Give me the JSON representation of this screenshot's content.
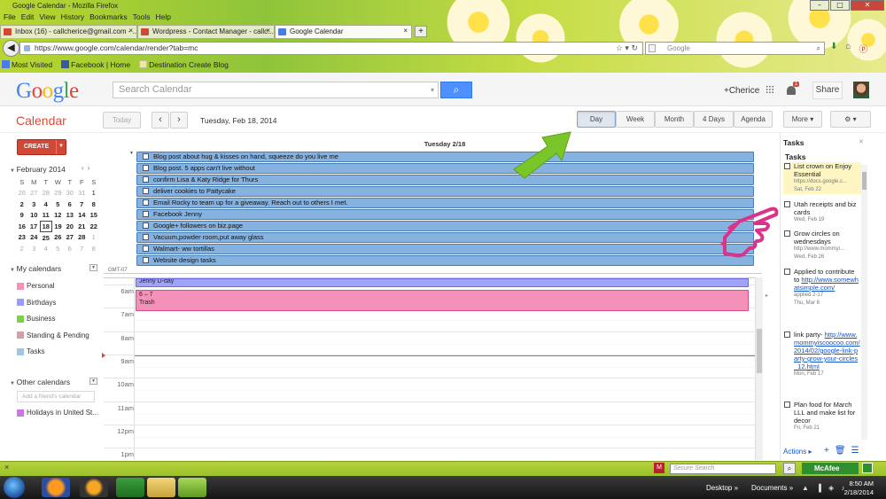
{
  "browser": {
    "window_title": "Google Calendar - Mozilla Firefox",
    "menu": [
      "File",
      "Edit",
      "View",
      "History",
      "Bookmarks",
      "Tools",
      "Help"
    ],
    "tabs": [
      {
        "label": "Inbox (16) - callcherice@gmail.com - ..."
      },
      {
        "label": "Wordpress - Contact Manager - callc..."
      },
      {
        "label": "Google Calendar"
      }
    ],
    "new_tab": "+",
    "url": "https://www.google.com/calendar/render?tab=mc",
    "search_placeholder": "Google",
    "bookmarks": [
      "Most Visited",
      "Facebook | Home",
      "Destination Create Blog"
    ]
  },
  "google_bar": {
    "logo": "Google",
    "search_placeholder": "Search Calendar",
    "user": "+Cherice",
    "notifications": "1",
    "share": "Share"
  },
  "calendar": {
    "title": "Calendar",
    "today": "Today",
    "date_label": "Tuesday, Feb 18, 2014",
    "views": [
      "Day",
      "Week",
      "Month",
      "4 Days",
      "Agenda"
    ],
    "selected_view": "Day",
    "more": "More ▾",
    "settings": "⚙ ▾",
    "create": "CREATE",
    "day_header": "Tuesday 2/18",
    "gmt": "GMT-07",
    "mini": {
      "month": "February 2014",
      "weekdays": [
        "S",
        "M",
        "T",
        "W",
        "T",
        "F",
        "S"
      ],
      "weeks": [
        [
          "26",
          "27",
          "28",
          "29",
          "30",
          "31",
          "1"
        ],
        [
          "2",
          "3",
          "4",
          "5",
          "6",
          "7",
          "8"
        ],
        [
          "9",
          "10",
          "11",
          "12",
          "13",
          "14",
          "15"
        ],
        [
          "16",
          "17",
          "18",
          "19",
          "20",
          "21",
          "22"
        ],
        [
          "23",
          "24",
          "25",
          "26",
          "27",
          "28",
          "1"
        ],
        [
          "2",
          "3",
          "4",
          "5",
          "6",
          "7",
          "8"
        ]
      ],
      "today": "18"
    },
    "my_calendars_label": "My calendars",
    "my_calendars": [
      {
        "name": "Personal",
        "color": "#f691b2"
      },
      {
        "name": "Birthdays",
        "color": "#9a9cff"
      },
      {
        "name": "Business",
        "color": "#7bd148"
      },
      {
        "name": "Standing & Pending",
        "color": "#d0a0a6"
      },
      {
        "name": "Tasks",
        "color": "#9fc6e7"
      }
    ],
    "other_calendars_label": "Other calendars",
    "friend_placeholder": "Add a friend's calendar",
    "other_calendars": [
      {
        "name": "Holidays in United St...",
        "color": "#cd74e6"
      }
    ],
    "all_day_tasks": [
      "Blog post about hug & kisses on hand, squeeze do you live me",
      "Blog post. 5 apps can't live without",
      "confirm Lisa & Katy Ridge for Thurs",
      "deliver cookies to Pattycake",
      "Email Rocky to team up for a giveaway. Reach out to others I met.",
      "Facebook Jenny",
      "Google+ followers on biz.page",
      "Vacuum,powder room,put away glass",
      "Walmart- ww tortillas",
      "Website design tasks"
    ],
    "hours": [
      "6am",
      "7am",
      "8am",
      "9am",
      "10am",
      "11am",
      "12pm",
      "1pm"
    ],
    "events": [
      {
        "title": "Jenny D-day"
      },
      {
        "time": "6 – 7",
        "title": "Trash"
      }
    ]
  },
  "tasks_panel": {
    "title": "Tasks",
    "list_name": "Tasks",
    "items": [
      {
        "title": "List crown on Enjoy Essential",
        "note": "https://docs.google.c...",
        "due": "Sat, Feb 22",
        "link": ""
      },
      {
        "title": "Utah receipts and biz cards",
        "note": "",
        "due": "Wed, Feb 19",
        "link": ""
      },
      {
        "title": "Grow circles on wednesdays",
        "note": "http://www.mommyi...",
        "due": "Wed, Feb 26",
        "link": ""
      },
      {
        "title": "Applied to contribute to",
        "link": "http://www.somewhatsimple.com/",
        "note": "applied 2-17",
        "due": "Thu, Mar 6"
      },
      {
        "title": "link party-",
        "link": "http://www.mommyiscoocoo.com/2014/02/google-link-party-grow-your-circles_12.html",
        "note": "",
        "due": "Mon, Feb 17"
      },
      {
        "title": "Plan food for March LLL and make list for decor",
        "note": "",
        "due": "Fri, Feb 21",
        "link": ""
      }
    ],
    "actions": "Actions ▸"
  },
  "status_bar": {
    "close": "×",
    "search_placeholder": "Secure Search",
    "mcafee": "McAfee"
  },
  "taskbar": {
    "desktop": "Desktop",
    "documents": "Documents",
    "time": "8:50 AM",
    "date": "2/18/2014"
  }
}
